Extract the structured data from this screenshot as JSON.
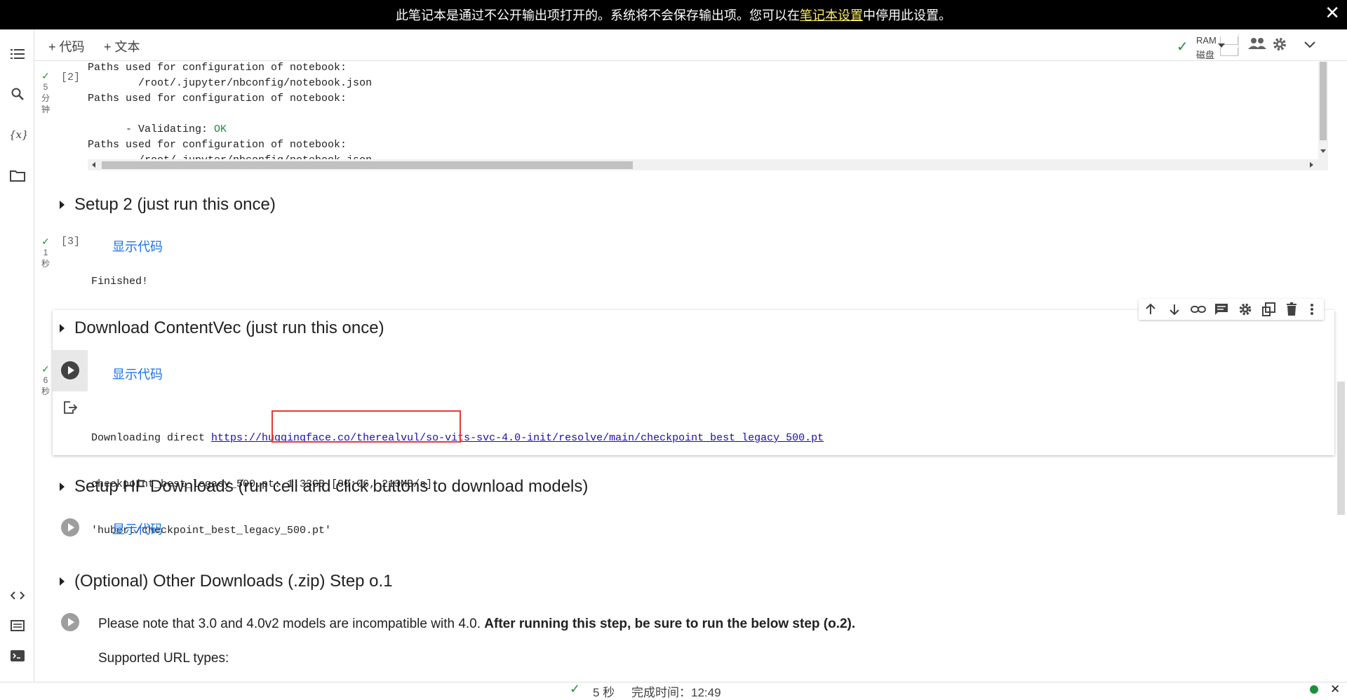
{
  "banner": {
    "text_before": "此笔记本是通过不公开输出项打开的。系统将不会保存输出项。您可以在",
    "link": "笔记本设置",
    "text_after": "中停用此设置。",
    "close": "✕"
  },
  "toolbar": {
    "add_code": "+ 代码",
    "add_text": "+ 文本",
    "ram_label": "RAM",
    "disk_label": "磁盘"
  },
  "cells": {
    "cell2": {
      "count": "[2]",
      "time_value": "5",
      "time_unit_1": "分",
      "time_unit_2": "钟",
      "lines": [
        "Paths used for configuration of notebook:",
        "        /root/.jupyter/nbconfig/notebook.json",
        "Paths used for configuration of notebook:",
        "",
        "      - Validating: ",
        "Paths used for configuration of notebook:",
        "        /root/.jupyter/nbconfig/notebook.json"
      ],
      "ok": "OK"
    },
    "setup2": {
      "title": "Setup 2 (just run this once)",
      "count": "[3]",
      "time_value": "1",
      "time_unit": "秒",
      "show_code": "显示代码",
      "output": "Finished!"
    },
    "contentvec": {
      "title": "Download ContentVec (just run this once)",
      "time_value": "6",
      "time_unit": "秒",
      "show_code": "显示代码",
      "out_prefix": "Downloading direct ",
      "url": "https://huggingface.co/therealvul/so-vits-svc-4.0-init/resolve/main/checkpoint_best_legacy_500.pt",
      "progress_line": "checkpoint_best_legacy_500.pt: 1.33GB [00:06, 213MB/s]",
      "result_line": "'hubert/checkpoint_best_legacy_500.pt'"
    },
    "hf": {
      "title": "Setup HF Downloads (run cell and click buttons to download models)",
      "show_code": "显示代码"
    },
    "optional": {
      "title": "(Optional) Other Downloads (.zip) Step o.1",
      "note_plain": "Please note that 3.0 and 4.0v2 models are incompatible with 4.0. ",
      "note_bold": "After running this step, be sure to run the below step (o.2).",
      "supported": "Supported URL types:"
    }
  },
  "status": {
    "duration": "5 秒",
    "done": "完成时间：12:49"
  },
  "colors": {
    "accent": "#1a73e8",
    "success": "#1e8e3e",
    "highlight_box": "#e53935"
  }
}
